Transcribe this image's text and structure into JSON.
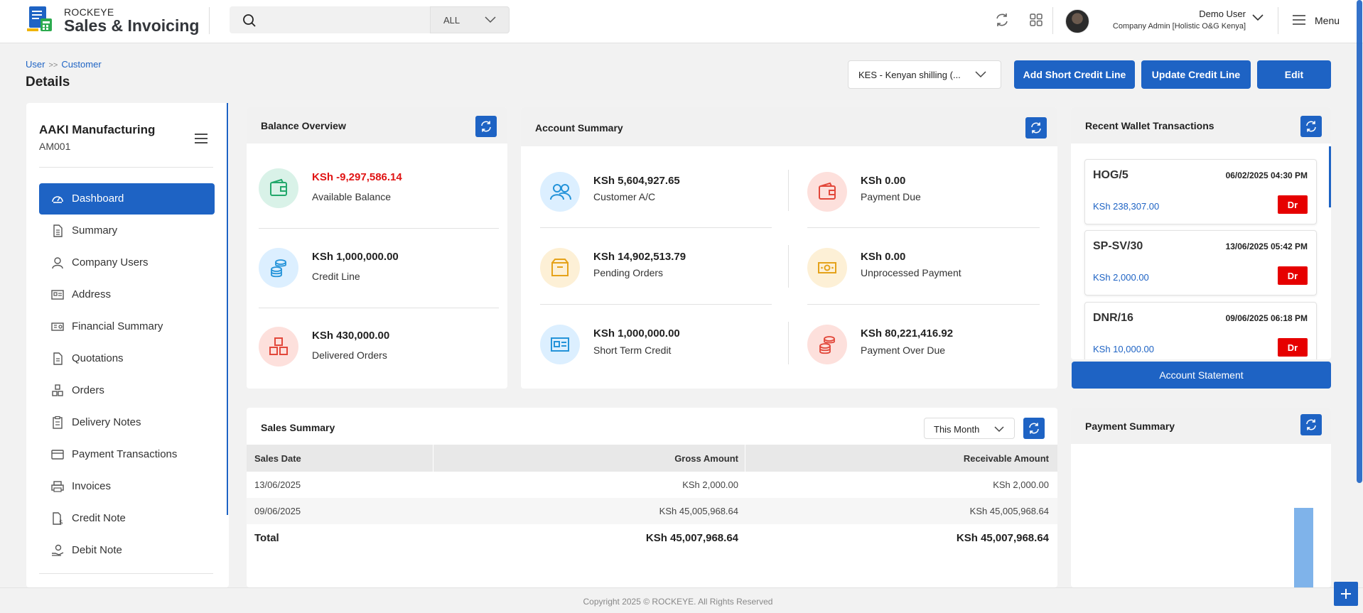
{
  "app": {
    "brand_small": "ROCKEYE",
    "brand_big": "Sales & Invoicing",
    "search_placeholder": "",
    "search_filter": "ALL",
    "user_name": "Demo User",
    "user_role": "Company Admin [Holistic O&G Kenya]",
    "menu_label": "Menu"
  },
  "breadcrumb": {
    "item1": "User",
    "item2": "Customer"
  },
  "page_title": "Details",
  "header_actions": {
    "currency": "KES - Kenyan shilling (...",
    "add_short_credit": "Add Short Credit Line",
    "update_credit": "Update Credit Line",
    "edit": "Edit"
  },
  "company": {
    "name": "AAKI Manufacturing",
    "code": "AM001"
  },
  "sidebar": {
    "items": [
      {
        "label": "Dashboard"
      },
      {
        "label": "Summary"
      },
      {
        "label": "Company Users"
      },
      {
        "label": "Address"
      },
      {
        "label": "Financial Summary"
      },
      {
        "label": "Quotations"
      },
      {
        "label": "Orders"
      },
      {
        "label": "Delivery Notes"
      },
      {
        "label": "Payment Transactions"
      },
      {
        "label": "Invoices"
      },
      {
        "label": "Credit Note"
      },
      {
        "label": "Debit Note"
      }
    ]
  },
  "balance_overview": {
    "title": "Balance Overview",
    "available_value": "KSh -9,297,586.14",
    "available_label": "Available Balance",
    "credit_value": "KSh 1,000,000.00",
    "credit_label": "Credit Line",
    "delivered_value": "KSh 430,000.00",
    "delivered_label": "Delivered Orders"
  },
  "account_summary": {
    "title": "Account Summary",
    "customer_value": "KSh 5,604,927.65",
    "customer_label": "Customer A/C",
    "payment_due_value": "KSh 0.00",
    "payment_due_label": "Payment Due",
    "pending_value": "KSh 14,902,513.79",
    "pending_label": "Pending Orders",
    "unprocessed_value": "KSh 0.00",
    "unprocessed_label": "Unprocessed Payment",
    "short_term_value": "KSh 1,000,000.00",
    "short_term_label": "Short Term Credit",
    "overdue_value": "KSh 80,221,416.92",
    "overdue_label": "Payment Over Due"
  },
  "wallet": {
    "title": "Recent Wallet Transactions",
    "items": [
      {
        "ref": "HOG/5",
        "date": "06/02/2025 04:30 PM",
        "amount": "KSh 238,307.00",
        "type": "Dr"
      },
      {
        "ref": "SP-SV/30",
        "date": "13/06/2025 05:42 PM",
        "amount": "KSh 2,000.00",
        "type": "Dr"
      },
      {
        "ref": "DNR/16",
        "date": "09/06/2025 06:18 PM",
        "amount": "KSh 10,000.00",
        "type": "Dr"
      }
    ],
    "statement_button": "Account Statement"
  },
  "sales_summary": {
    "title": "Sales Summary",
    "period": "This Month",
    "columns": [
      "Sales Date",
      "Gross Amount",
      "Receivable Amount"
    ],
    "rows": [
      [
        "13/06/2025",
        "KSh 2,000.00",
        "KSh 2,000.00"
      ],
      [
        "09/06/2025",
        "KSh 45,005,968.64",
        "KSh 45,005,968.64"
      ]
    ],
    "total": [
      "Total",
      "KSh 45,007,968.64",
      "KSh 45,007,968.64"
    ]
  },
  "payment_summary": {
    "title": "Payment Summary"
  },
  "footer": "Copyright 2025 © ROCKEYE. All Rights Reserved",
  "colors": {
    "primary": "#1e63c4",
    "danger": "#e60000",
    "negative": "#e01414"
  }
}
